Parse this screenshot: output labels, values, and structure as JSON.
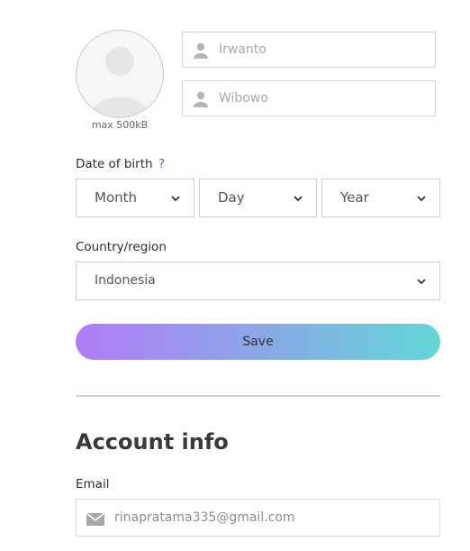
{
  "profile": {
    "avatar_hint": "max 500kB",
    "first_name_placeholder": "Irwanto",
    "last_name_placeholder": "Wibowo"
  },
  "dob": {
    "label": "Date of birth",
    "help": "?",
    "month": "Month",
    "day": "Day",
    "year": "Year"
  },
  "country": {
    "label": "Country/region",
    "selected": "Indonesia"
  },
  "actions": {
    "save_label": "Save"
  },
  "account": {
    "title": "Account info",
    "email_label": "Email",
    "email_value": "rinapratama335@gmail.com"
  },
  "icons": {
    "person": "person-icon",
    "chevron": "chevron-down-icon",
    "mail": "mail-icon"
  },
  "colors": {
    "gradient_start": "#b07cf6",
    "gradient_mid": "#8fa2ea",
    "gradient_end": "#62d6d6",
    "help_accent": "#4a6fa5"
  }
}
